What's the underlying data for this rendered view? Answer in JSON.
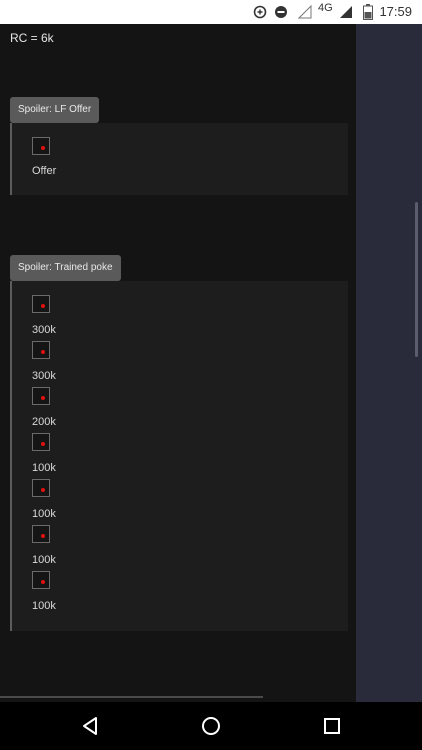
{
  "status_bar": {
    "network": "4G",
    "time": "17:59"
  },
  "content": {
    "rc_text": "RC = 6k",
    "spoilers": [
      {
        "button_label": "Spoiler: LF Offer",
        "items": [
          {
            "label": "Offer"
          }
        ]
      },
      {
        "button_label": "Spoiler: Trained poke",
        "items": [
          {
            "label": "300k"
          },
          {
            "label": "300k"
          },
          {
            "label": "200k"
          },
          {
            "label": "100k"
          },
          {
            "label": "100k"
          },
          {
            "label": "100k"
          },
          {
            "label": "100k"
          }
        ]
      }
    ]
  },
  "colors": {
    "background": "#141414",
    "spoiler_button": "#5a5a5a",
    "spoiler_body": "#1d1d1d",
    "side_panel": "#2a2b3a",
    "checkbox_dot": "#e01010"
  },
  "nav_icons": [
    "back-icon",
    "home-icon",
    "recents-icon"
  ]
}
